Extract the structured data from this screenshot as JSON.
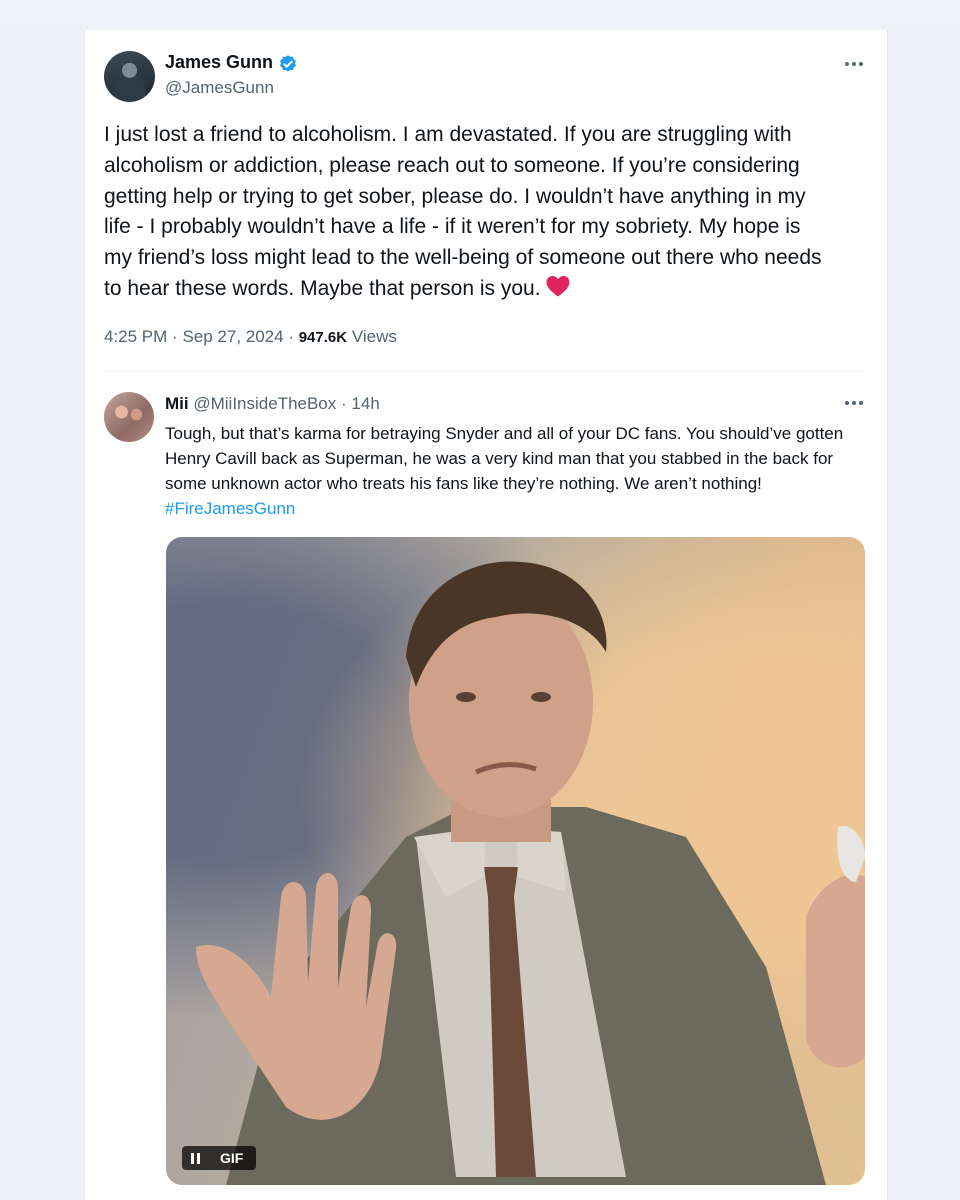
{
  "tweet": {
    "author_name": "James Gunn",
    "author_handle": "@JamesGunn",
    "text": "I just lost a friend to alcoholism. I am devastated. If you are struggling with\nalcoholism or addiction, please reach out to someone. If you’re considering\ngetting help or trying to get sober, please do. I wouldn’t have anything in my\nlife - I probably wouldn’t have a life - if it weren’t for my sobriety. My hope is\nmy friend’s loss might lead to the well-being of someone out there who needs\nto hear these words. Maybe that person is you.",
    "time": "4:25 PM",
    "date": "Sep 27, 2024",
    "views_count": "947.6K",
    "views_label": "Views"
  },
  "reply": {
    "author_name": "Mii",
    "author_handle": "@MiiInsideTheBox",
    "age": "14h",
    "text": "Tough, but that’s karma for betraying Snyder and all of your DC fans. You should’ve gotten Henry Cavill back as Superman, he was a very kind man that you stabbed in the back for some unknown actor who treats his fans like they’re nothing. We aren’t nothing! ",
    "hashtag": "#FireJamesGunn",
    "gif_label": "GIF"
  },
  "colors": {
    "verified": "#1d9bf0",
    "link": "#1d9bf0",
    "heart": "#e0245e",
    "secondary_text": "#536471"
  },
  "icons": [
    "verified-badge-icon",
    "more-icon",
    "heart-emoji-icon",
    "pause-icon"
  ]
}
